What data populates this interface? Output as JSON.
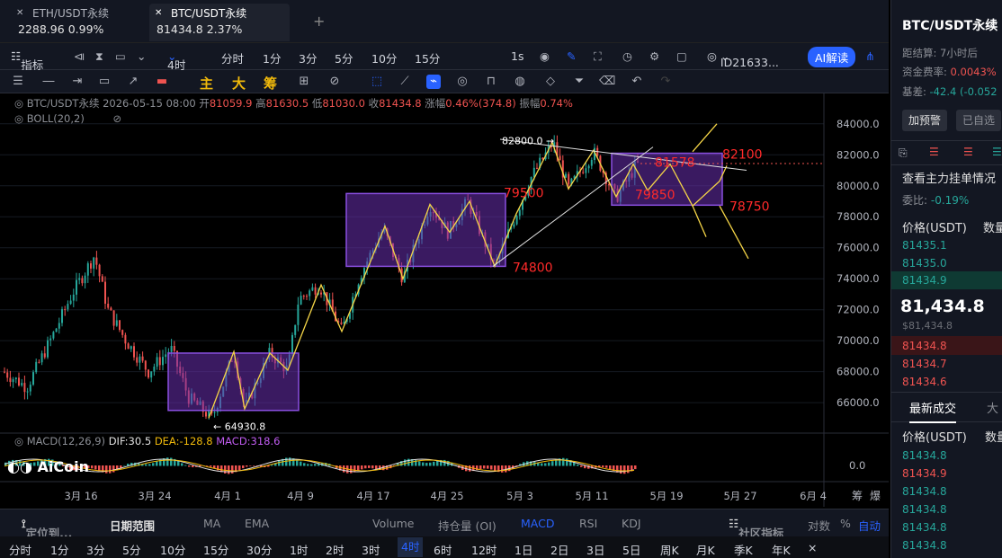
{
  "tabs": [
    {
      "name": "ETH/USDT永续",
      "price": "2288.96",
      "change": "0.99%"
    },
    {
      "name": "BTC/USDT永续",
      "price": "81434.8",
      "change": "2.37%"
    }
  ],
  "toolbar": {
    "indicators": "指标",
    "interval": "4时",
    "times": [
      "分时",
      "1分",
      "3分",
      "5分",
      "10分",
      "15分"
    ],
    "seconds": "1s",
    "account": "ID21633...",
    "ai": "AI解读"
  },
  "drawbar": {
    "main": "主",
    "big": "大",
    "chip": "筹"
  },
  "ohlc": {
    "symbol": "BTC/USDT永续",
    "date": "2026-05-15 08:00",
    "open_label": "开",
    "open": "81059.9",
    "high_label": "高",
    "high": "81630.5",
    "low_label": "低",
    "low": "81030.0",
    "close_label": "收",
    "close": "81434.8",
    "chg_label": "涨幅",
    "chg": "0.46%(374.8)",
    "amp_label": "振幅",
    "amp": "0.74%"
  },
  "boll": "BOLL(20,2)",
  "macd": {
    "label": "MACD(12,26,9)",
    "dif": "DIF:30.5",
    "dea": "DEA:-128.8",
    "macd": "MACD:318.6",
    "zero": "0.0"
  },
  "logo": "AiCoin",
  "chart_data": {
    "type": "candlestick",
    "y_ticks": [
      "84000.0",
      "82000.0",
      "80000.0",
      "78000.0",
      "76000.0",
      "74000.0",
      "72000.0",
      "70000.0",
      "68000.0",
      "66000.0"
    ],
    "x_ticks": [
      "3月 16",
      "3月 24",
      "4月 1",
      "4月 9",
      "4月 17",
      "4月 25",
      "5月 3",
      "5月 11",
      "5月 19",
      "5月 27",
      "6月 4"
    ],
    "ylim": [
      64500,
      84800
    ],
    "last_price": "81434.8",
    "annotations": {
      "low": "← 64930.8",
      "high": "82800.0 →",
      "l79500": "79500",
      "l74800": "74800",
      "l81578": "81578",
      "l79850": "79850",
      "l82100": "82100",
      "l78750": "78750"
    },
    "corner": [
      "筹",
      "爆"
    ]
  },
  "bottom": {
    "locate": "定位到...",
    "range": "日期范围",
    "inds": [
      "MA",
      "EMA",
      "Volume",
      "持仓量 (OI)",
      "MACD",
      "RSI",
      "KDJ"
    ],
    "community": "社区指标",
    "log": "对数",
    "pct": "%",
    "auto": "自动"
  },
  "periods": [
    "分时",
    "1分",
    "3分",
    "5分",
    "10分",
    "15分",
    "30分",
    "1时",
    "2时",
    "3时",
    "4时",
    "6时",
    "12时",
    "1日",
    "2日",
    "3日",
    "5日",
    "周K",
    "月K",
    "季K",
    "年K"
  ],
  "panel": {
    "title": "BTC/USDT永续",
    "settle_label": "距结算:",
    "settle": "7小时后",
    "fund_label": "资金费率:",
    "fund": "0.0043%",
    "basis_label": "基差:",
    "basis": "-42.4",
    "basis_pct": "(-0.052",
    "alert": "加预警",
    "fav": "已自选",
    "depth": "查看主力挂单情况",
    "ratio_label": "委比:",
    "ratio": "-0.19%",
    "price_col": "价格(USDT)",
    "qty_col": "数量",
    "asks": [
      "81435.1",
      "81435.0",
      "81434.9"
    ],
    "last": "81,434.8",
    "last_sub": "$81,434.8",
    "bids": [
      "81434.8",
      "81434.7",
      "81434.6"
    ],
    "trades_tab": "最新成交",
    "big_tab": "大",
    "trades": [
      {
        "p": "81434.8",
        "c": "g"
      },
      {
        "p": "81434.9",
        "c": "r"
      },
      {
        "p": "81434.8",
        "c": "g"
      },
      {
        "p": "81434.8",
        "c": "g"
      },
      {
        "p": "81434.8",
        "c": "g"
      },
      {
        "p": "81434.8",
        "c": "g"
      }
    ]
  },
  "colors": {
    "up": "#26a69a",
    "down": "#ef5350",
    "accent": "#2962ff",
    "annot": "#ff2a2a",
    "box": "#6a2fb0",
    "wave": "#f5d547"
  }
}
